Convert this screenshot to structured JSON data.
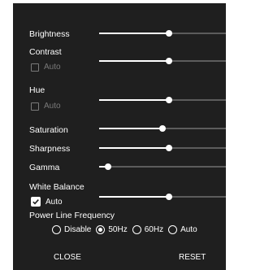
{
  "controls": {
    "brightness": {
      "label": "Brightness",
      "value": 0.55
    },
    "contrast": {
      "label": "Contrast",
      "value": 0.55,
      "auto_label": "Auto",
      "auto_checked": false,
      "auto_enabled": false
    },
    "hue": {
      "label": "Hue",
      "value": 0.55,
      "auto_label": "Auto",
      "auto_checked": false,
      "auto_enabled": false
    },
    "saturation": {
      "label": "Saturation",
      "value": 0.5
    },
    "sharpness": {
      "label": "Sharpness",
      "value": 0.55
    },
    "gamma": {
      "label": "Gamma",
      "value": 0.07
    },
    "white_balance": {
      "label": "White Balance",
      "value": 0.55,
      "auto_label": "Auto",
      "auto_checked": true,
      "auto_enabled": true
    }
  },
  "power_line": {
    "label": "Power Line Frequency",
    "options": [
      {
        "label": "Disable",
        "selected": false
      },
      {
        "label": "50Hz",
        "selected": true
      },
      {
        "label": "60Hz",
        "selected": false
      },
      {
        "label": "Auto",
        "selected": false
      }
    ]
  },
  "buttons": {
    "close": "CLOSE",
    "reset": "RESET"
  },
  "colors": {
    "background": "#1f1f1f",
    "text": "#ffffff",
    "disabled": "#7a7a7a",
    "track": "#5c5c5c"
  }
}
